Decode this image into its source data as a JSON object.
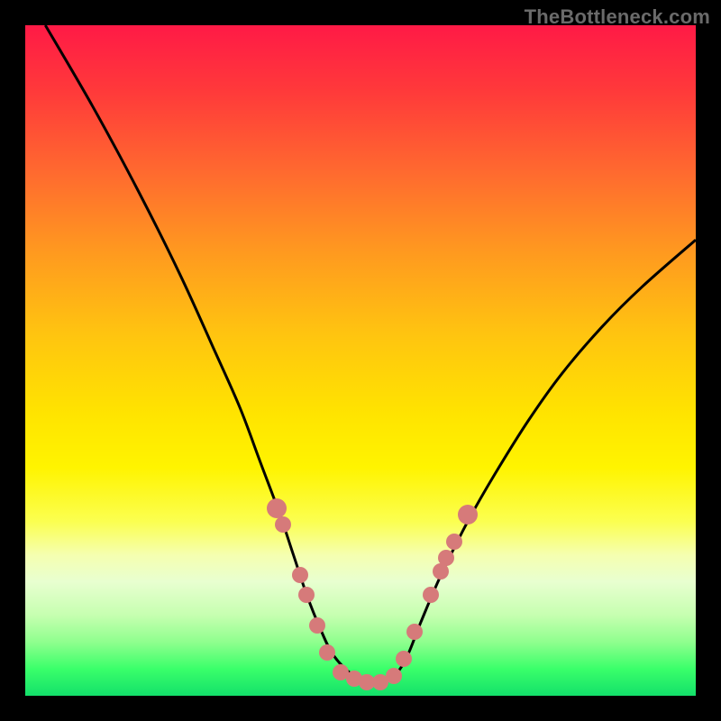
{
  "watermark": "TheBottleneck.com",
  "colors": {
    "frame_bg": "#000000",
    "curve": "#000000",
    "dot": "#d67a7a"
  },
  "chart_data": {
    "type": "line",
    "title": "",
    "xlabel": "",
    "ylabel": "",
    "xlim": [
      0,
      100
    ],
    "ylim": [
      0,
      100
    ],
    "series": [
      {
        "name": "bottleneck-curve",
        "x": [
          3,
          10,
          17,
          23,
          28,
          32,
          35,
          38,
          40,
          42,
          44,
          46,
          49,
          52,
          55,
          57,
          59,
          62,
          66,
          70,
          75,
          80,
          86,
          92,
          100
        ],
        "y": [
          100,
          88,
          75,
          63,
          52,
          43,
          35,
          27,
          21,
          15,
          10,
          6,
          3,
          2,
          3,
          6,
          11,
          18,
          26,
          33,
          41,
          48,
          55,
          61,
          68
        ]
      }
    ],
    "markers": {
      "name": "highlight-dots",
      "points": [
        {
          "x": 37.5,
          "y": 28
        },
        {
          "x": 38.5,
          "y": 25.5
        },
        {
          "x": 41,
          "y": 18
        },
        {
          "x": 42,
          "y": 15
        },
        {
          "x": 43.5,
          "y": 10.5
        },
        {
          "x": 45,
          "y": 6.5
        },
        {
          "x": 47,
          "y": 3.5
        },
        {
          "x": 49,
          "y": 2.5
        },
        {
          "x": 51,
          "y": 2
        },
        {
          "x": 53,
          "y": 2
        },
        {
          "x": 55,
          "y": 3
        },
        {
          "x": 56.5,
          "y": 5.5
        },
        {
          "x": 58,
          "y": 9.5
        },
        {
          "x": 60.5,
          "y": 15
        },
        {
          "x": 62,
          "y": 18.5
        },
        {
          "x": 62.8,
          "y": 20.5
        },
        {
          "x": 64,
          "y": 23
        },
        {
          "x": 66,
          "y": 27
        }
      ]
    }
  }
}
